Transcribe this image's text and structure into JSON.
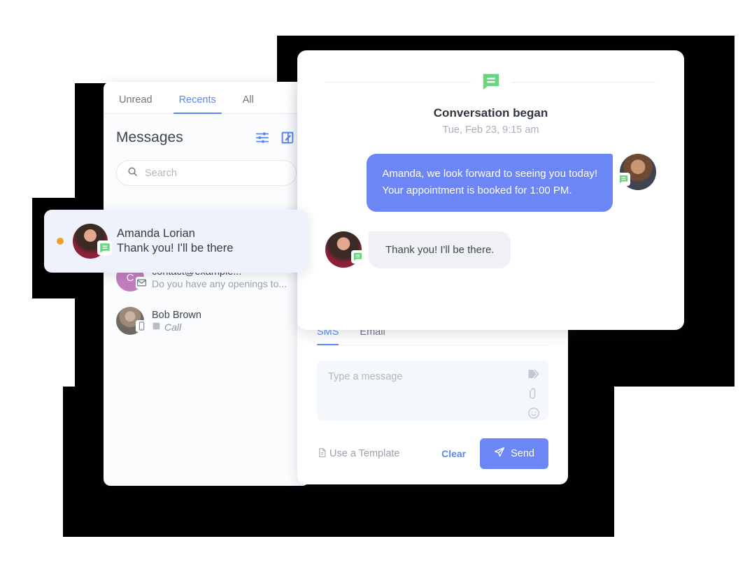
{
  "list_panel": {
    "tabs": [
      {
        "label": "Unread",
        "active": false
      },
      {
        "label": "Recents",
        "active": true
      },
      {
        "label": "All",
        "active": false
      }
    ],
    "title": "Messages",
    "filter_icon": "sliders-filter-icon",
    "compose_icon": "compose-pencil-icon",
    "search": {
      "placeholder": "Search",
      "icon": "search-icon"
    },
    "rows": [
      {
        "name": "contact@example...",
        "preview": "Do you have any openings to...",
        "avatar_letter": "C",
        "avatar_color": "#c07dbd",
        "channel_icon": "envelope-icon"
      },
      {
        "name": "Bob Brown",
        "preview": "Call",
        "preview_italic": true,
        "channel_icon": "mobile-phone-icon",
        "preview_icon": "phone-icon"
      }
    ]
  },
  "highlighted_row": {
    "name": "Amanda Lorian",
    "preview": "Thank you! I'll be there",
    "unread_dot_color": "#f0a024",
    "channel_icon": "sms-chat-icon"
  },
  "conversation": {
    "header_icon": "sms-chat-icon",
    "title": "Conversation began",
    "date": "Tue, Feb 23, 9:15 am",
    "messages": [
      {
        "direction": "outgoing",
        "lines": [
          "Amanda, we look forward to seeing you today!",
          "Your appointment is booked for 1:00 PM."
        ],
        "bubble_color": "#6c87f5",
        "channel_icon": "sms-chat-icon"
      },
      {
        "direction": "incoming",
        "lines": [
          "Thank you! I'll be there."
        ],
        "bubble_color": "#eff1f6",
        "channel_icon": "sms-chat-icon"
      }
    ]
  },
  "composer": {
    "tabs": [
      {
        "label": "SMS",
        "active": true
      },
      {
        "label": "Email",
        "active": false
      }
    ],
    "input_placeholder": "Type a message",
    "input_value": "",
    "icons": [
      "tag-label-icon",
      "paperclip-icon",
      "emoji-smiley-icon"
    ],
    "template_label": "Use a Template",
    "template_icon": "document-icon",
    "clear_label": "Clear",
    "send_label": "Send",
    "send_icon": "paper-plane-icon",
    "send_color": "#6c87f5"
  }
}
